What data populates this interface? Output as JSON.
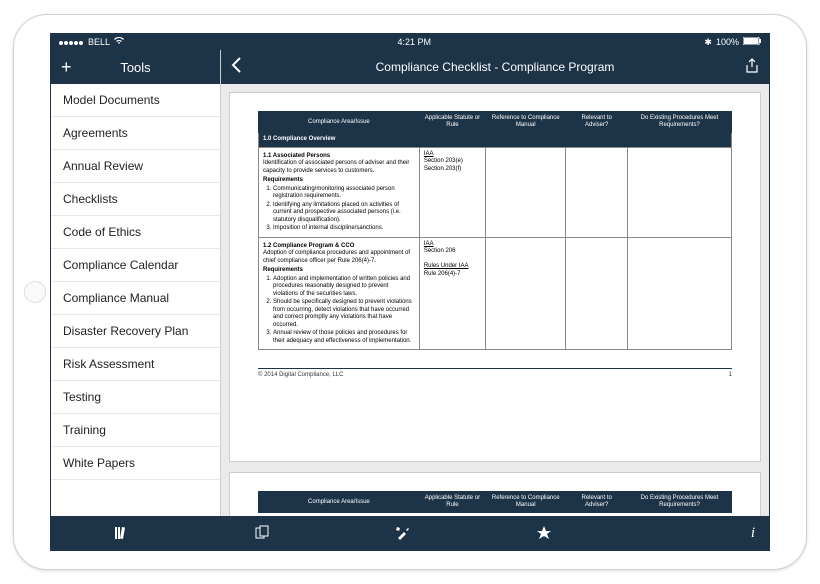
{
  "status": {
    "carrier": "BELL",
    "time": "4:21 PM",
    "battery": "100%"
  },
  "sidebar": {
    "title": "Tools",
    "items": [
      "Model Documents",
      "Agreements",
      "Annual Review",
      "Checklists",
      "Code of Ethics",
      "Compliance Calendar",
      "Compliance Manual",
      "Disaster Recovery Plan",
      "Risk Assessment",
      "Testing",
      "Training",
      "White Papers"
    ]
  },
  "main": {
    "title": "Compliance Checklist - Compliance Program"
  },
  "doc": {
    "headers": [
      "Compliance Area/Issue",
      "Applicable Statute or Rule",
      "Reference to Compliance Manual",
      "Relevant to Adviser?",
      "Do Existing Procedures Meet Requirements?"
    ],
    "section": "1.0  Compliance Overview",
    "row1": {
      "title": "1.1  Associated Persons",
      "desc": "Identification of associated persons of adviser and their capacity to provide services to customers.",
      "req_label": "Requirements",
      "reqs": [
        "Communicating/monitoring associated person registration requirements.",
        "Identifying any limitations placed on activities of current and prospective associated persons (i.e. statutory disqualification).",
        "Imposition of internal discipline/sanctions."
      ],
      "rule1": "IAA",
      "rule2": "Section 203(e)",
      "rule3": "Section 203(f)"
    },
    "row2": {
      "title": "1.2  Compliance Program & CCO",
      "desc": "Adoption of compliance procedures and appointment of chief compliance officer per Rule 206(4)-7.",
      "req_label": "Requirements",
      "reqs": [
        "Adoption and implementation of written policies and procedures reasonably designed to prevent violations of the securities laws.",
        "Should be specifically designed to prevent violations from occurring, detect violations that have occurred and correct promptly any violations that have occurred.",
        "Annual review of those policies and procedures for their adequacy and effectiveness of implementation."
      ],
      "rule1": "IAA",
      "rule2": "Section 206",
      "rule3": "Rules Under IAA",
      "rule4": "Rule 206(4)-7"
    },
    "footer_left": "© 2014 Digital Compliance, LLC",
    "footer_right": "1"
  }
}
